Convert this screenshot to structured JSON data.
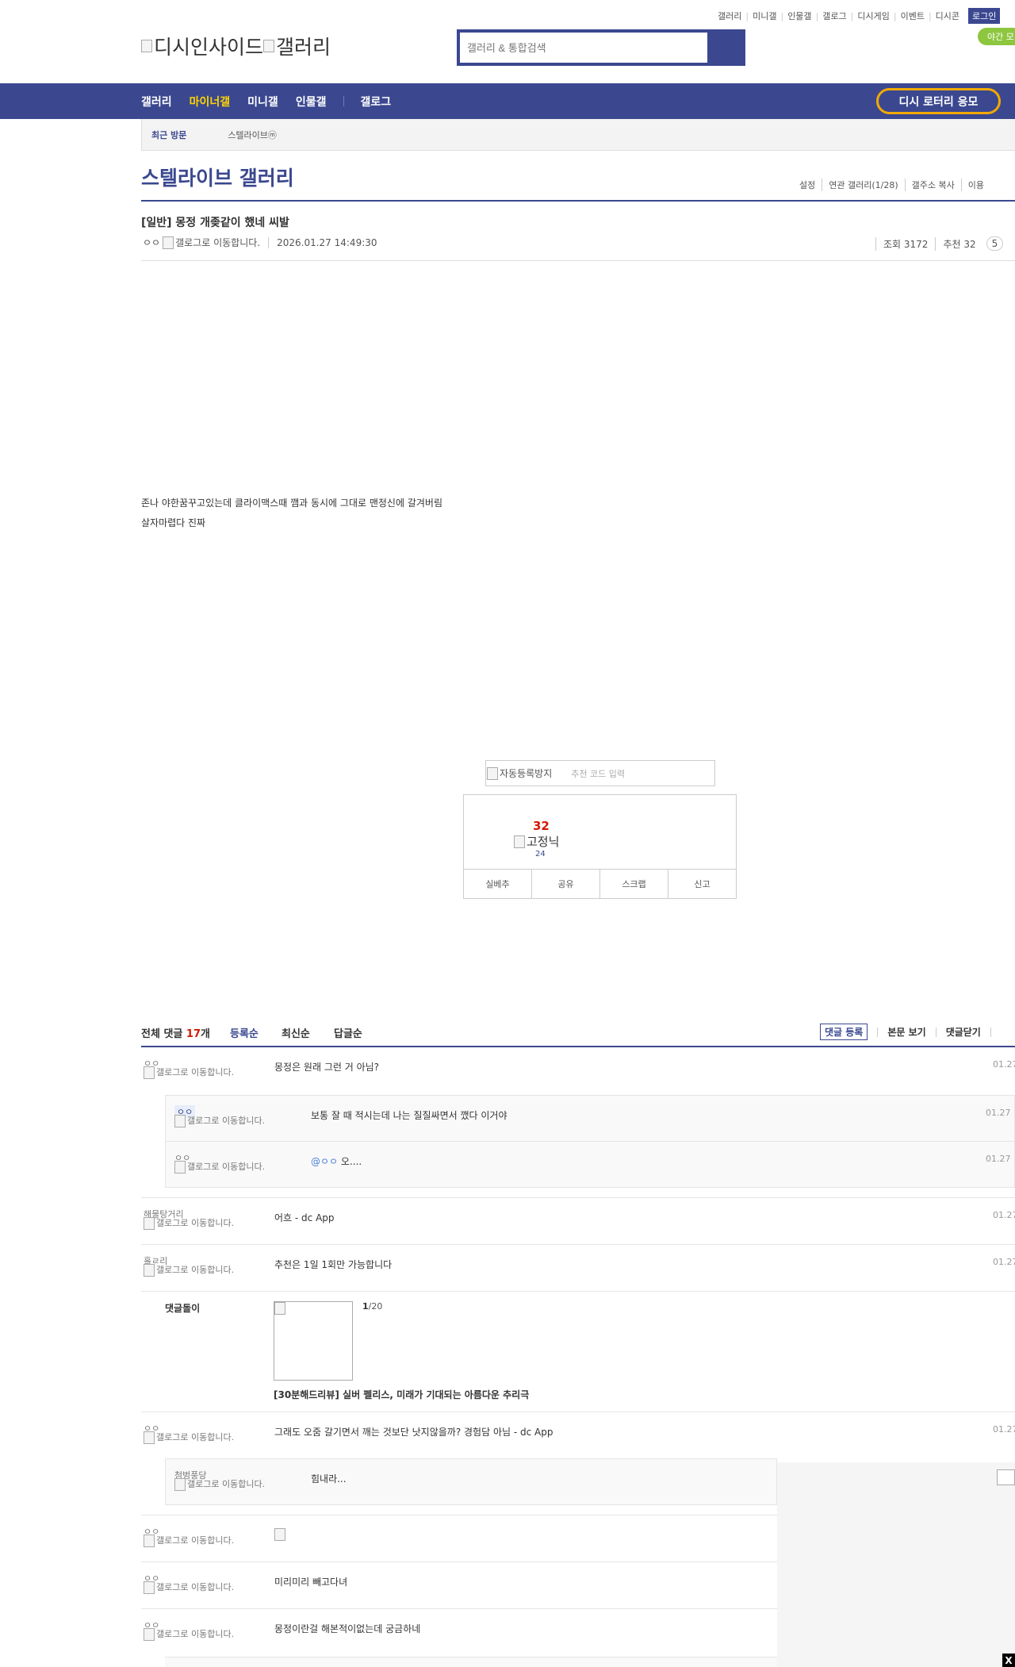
{
  "header": {
    "top_links": [
      "갤러리",
      "미니갤",
      "인물갤",
      "갤로그",
      "디시게임",
      "이벤트",
      "디시콘"
    ],
    "login_label": "로그인",
    "night_label": "야간 모",
    "logo_alt_1": "디시인사이드",
    "logo_alt_2": "갤러리",
    "search_placeholder": "갤러리 & 통합검색"
  },
  "gnb": {
    "items": [
      "갤러리",
      "마이너갤",
      "미니갤",
      "인물갤",
      "갤로그"
    ],
    "active_index": 1,
    "lottery_label": "디시 로터리 응모"
  },
  "recent": {
    "label": "최근 방문",
    "item": "스텔라이브ⓜ"
  },
  "gallery": {
    "title": "스텔라이브 갤러리",
    "menu": [
      "설정",
      "연관 갤러리(1/28)",
      "갤주소 복사",
      "이용"
    ]
  },
  "post": {
    "title": "[일반] 몽정 개좆같이 했네 씨발",
    "author": "ㅇㅇ",
    "author_img_alt": "갤로그로 이동합니다.",
    "date": "2026.01.27 14:49:30",
    "views": "조회 3172",
    "recommend": "추천 32",
    "comment_pill": "5",
    "body_lines": [
      "존나 야한꿈꾸고있는데 클라이맥스때 깸과 동시에 그대로 맨정신에 갈겨버림",
      "살자마렵다 진짜"
    ]
  },
  "recommend_box": {
    "captcha_alt": "자동등록방지",
    "captcha_placeholder": "추천 코드 입력",
    "count": "32",
    "fixed_alt": "고정닉",
    "fixed_count": "24",
    "buttons": [
      "실베추",
      "공유",
      "스크랩",
      "신고"
    ]
  },
  "comments_header": {
    "total_label": "전체 댓글",
    "total_count": "17",
    "total_unit": "개",
    "sorts": [
      "등록순",
      "최신순",
      "답글순"
    ],
    "actions": [
      "댓글 등록",
      "본문 보기",
      "댓글닫기"
    ]
  },
  "comments": [
    {
      "nick": "ㅇㅇ",
      "ip": "갤로그로 이동합니다.",
      "text": "몽정은 원래 그런 거 아님?",
      "time": "01.27"
    },
    {
      "nick": "해물탕거리",
      "ip": "갤로그로 이동합니다.",
      "text": "어흐 - dc App",
      "time": "01.27"
    },
    {
      "nick": "홀ㄹ리",
      "ip": "갤로그로 이동합니다.",
      "text": "추천은 1일 1회만 가능합니다",
      "time": "01.27"
    },
    {
      "nick": "ㅇㅇ",
      "ip": "갤로그로 이동합니다.",
      "text": "그래도 오줌 갈기면서 깨는 것보단 낫지않을까? 경험담 아님 - dc App",
      "time": "01.27"
    },
    {
      "nick": "ㅇㅇ",
      "ip": "갤로그로 이동합니다.",
      "text": "",
      "time": ""
    },
    {
      "nick": "ㅇㅇ",
      "ip": "갤로그로 이동합니다.",
      "text": "미리미리 빼고다녀",
      "time": ""
    },
    {
      "nick": "ㅇㅇ",
      "ip": "갤로그로 이동합니다.",
      "text": "몽정이란걸 해본적이없는데 궁금하네",
      "time": ""
    }
  ],
  "replies": [
    {
      "nick": "ㅇㅇ",
      "ip": "갤로그로 이동합니다.",
      "text": "보통 잘 때 적시는데 나는 질질싸면서 깼다 이거야",
      "time": "01.27"
    },
    {
      "nick": "ㅇㅇ",
      "ip": "갤로그로 이동합니다.",
      "mention": "@ㅇㅇ",
      "text": " 오....",
      "time": "01.27"
    },
    {
      "nick": "첨벙풍당",
      "ip": "갤로그로 이동합니다.",
      "text": "힘내라...",
      "time": ""
    }
  ],
  "ad_comment": {
    "bot": "댓글돌이",
    "page_current": "1",
    "page_total": "/20",
    "title": "[30분해드리뷰] 실버 펠리스, 미래가 기대되는 아름다운 추리극"
  },
  "close_label": "X",
  "colors": {
    "brand": "#3b4890",
    "highlight": "#ffd400",
    "accent_red": "#d31900",
    "night_green": "#8dc63f",
    "lottery_border": "#f2a900"
  }
}
